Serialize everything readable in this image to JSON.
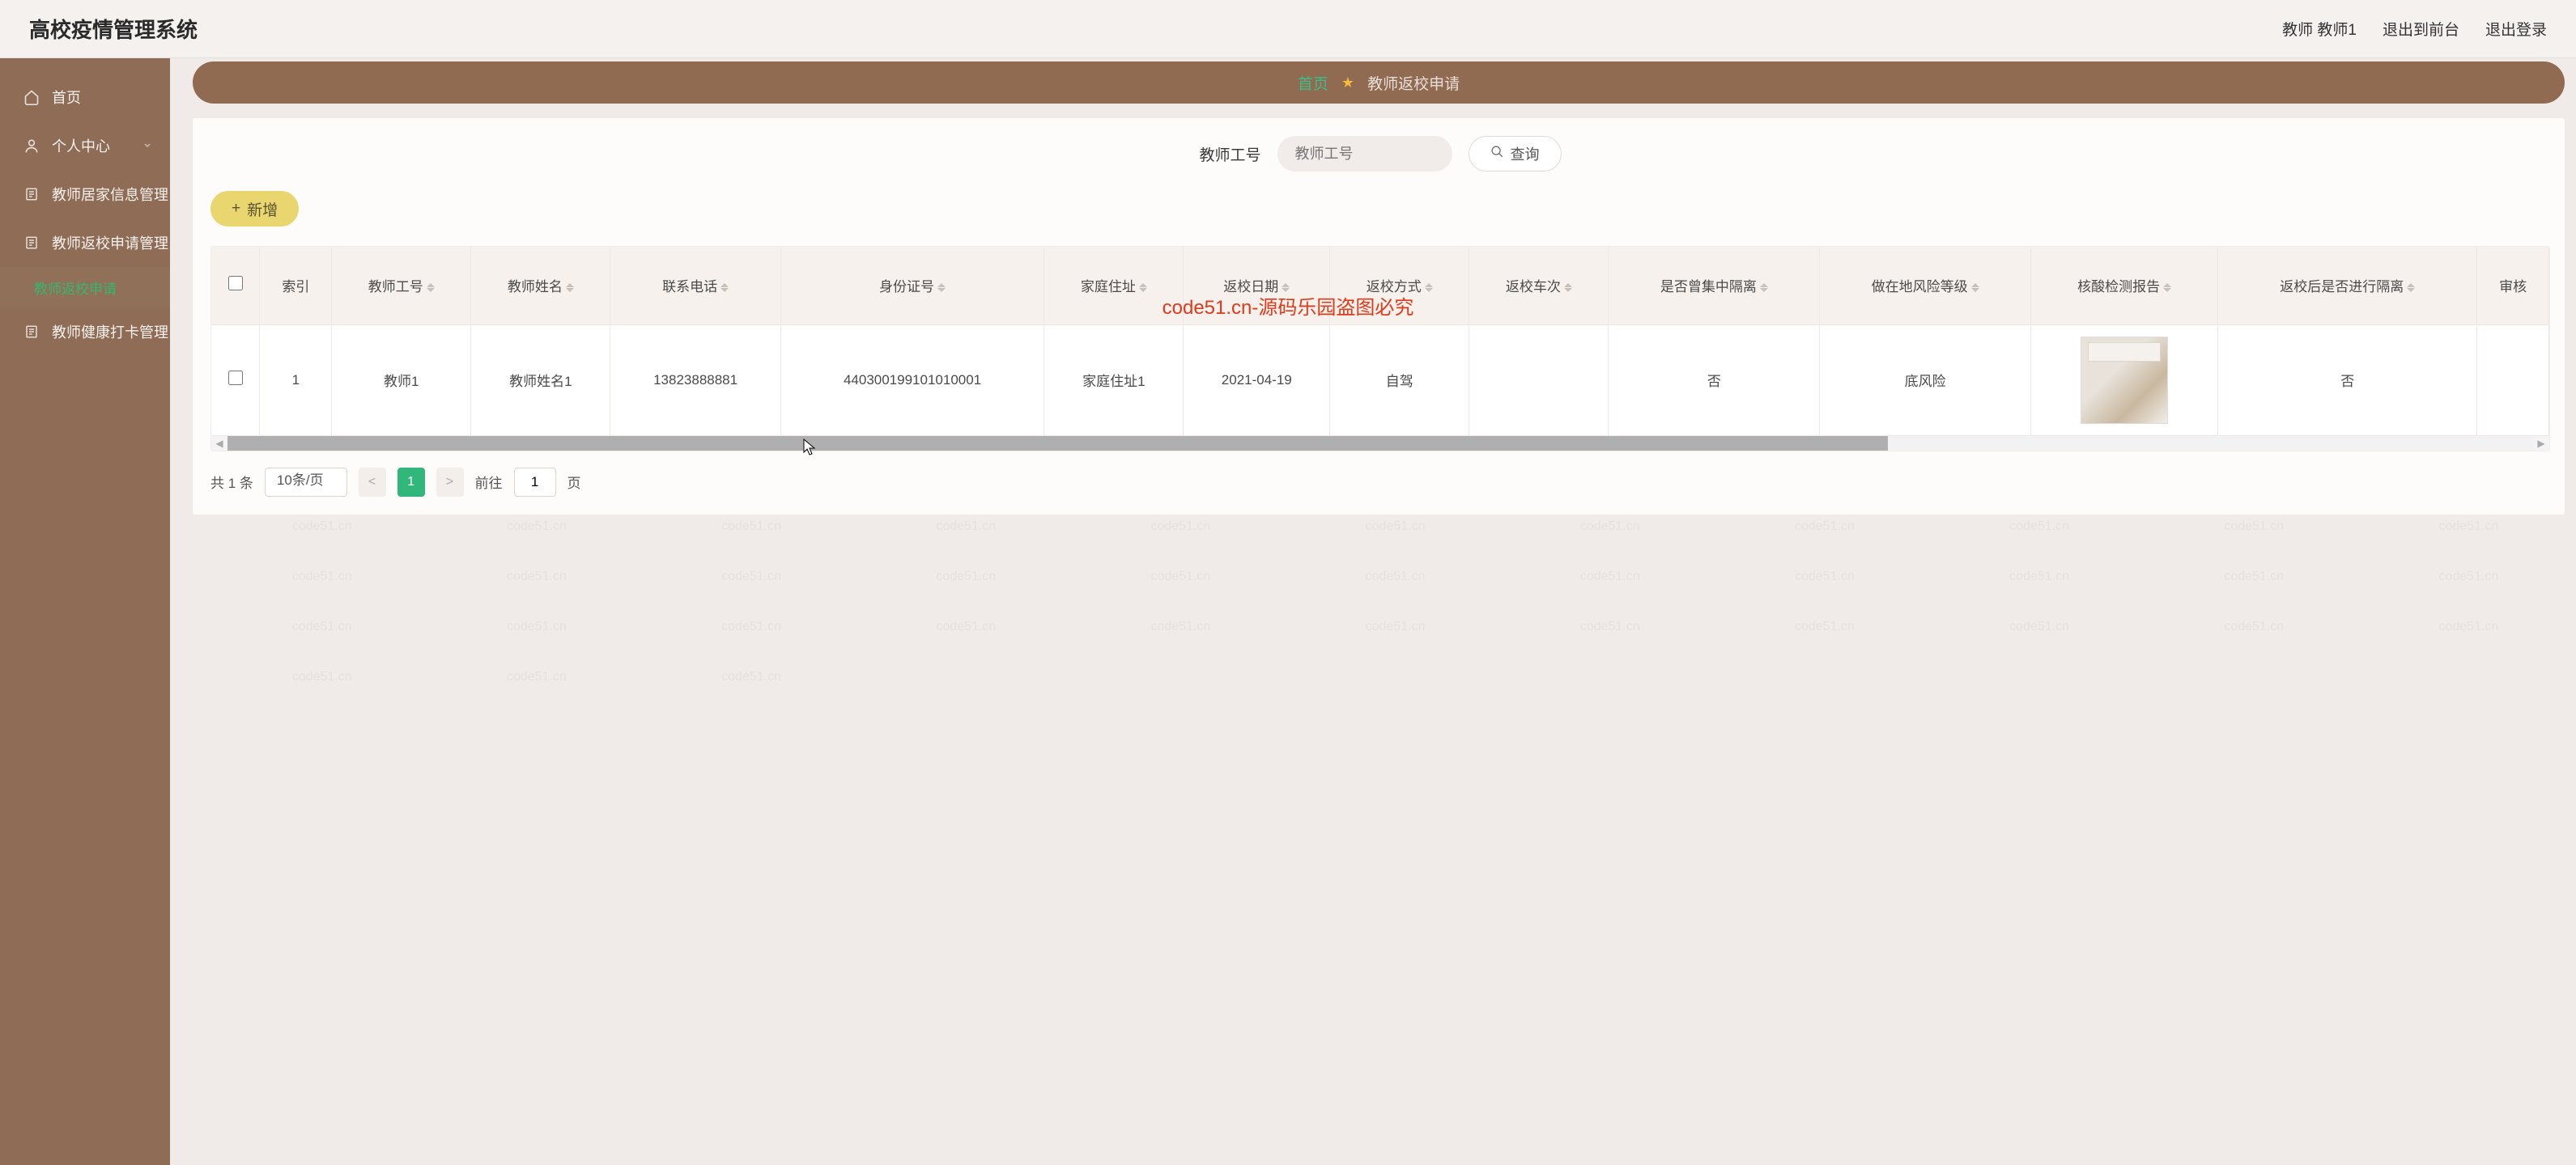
{
  "header": {
    "title": "高校疫情管理系统",
    "user_label": "教师 教师1",
    "exit_front": "退出到前台",
    "logout": "退出登录"
  },
  "sidebar": {
    "items": [
      {
        "icon": "home-icon",
        "label": "首页",
        "has_chevron": false
      },
      {
        "icon": "user-icon",
        "label": "个人中心",
        "has_chevron": true
      },
      {
        "icon": "doc-icon",
        "label": "教师居家信息管理",
        "has_chevron": false
      },
      {
        "icon": "doc-icon",
        "label": "教师返校申请管理",
        "has_chevron": true
      },
      {
        "icon": "doc-icon",
        "label": "教师健康打卡管理",
        "has_chevron": false
      }
    ],
    "active_subitem": "教师返校申请"
  },
  "breadcrumb": {
    "home": "首页",
    "current": "教师返校申请"
  },
  "search": {
    "label": "教师工号",
    "placeholder": "教师工号",
    "button": "查询"
  },
  "toolbar": {
    "add_label": "新增"
  },
  "table": {
    "columns": [
      "索引",
      "教师工号",
      "教师姓名",
      "联系电话",
      "身份证号",
      "家庭住址",
      "返校日期",
      "返校方式",
      "返校车次",
      "是否曾集中隔离",
      "做在地风险等级",
      "核酸检测报告",
      "返校后是否进行隔离",
      "审核"
    ],
    "rows": [
      {
        "index": "1",
        "teacher_id": "教师1",
        "teacher_name": "教师姓名1",
        "phone": "138238888​81",
        "id_card": "440300199101010001",
        "address": "家庭住址1",
        "return_date": "2021-04-19",
        "return_method": "自驾",
        "train_no": "",
        "was_quarantined": "否",
        "risk_level": "底风险",
        "report_img": "thumb",
        "post_quarantine": "否",
        "audit": ""
      }
    ]
  },
  "pagination": {
    "total_text": "共 1 条",
    "page_size": "10条/页",
    "current_page": "1",
    "goto_label": "前往",
    "goto_value": "1",
    "page_suffix": "页"
  },
  "watermark": {
    "cell": "code51.cn",
    "center": "code51.cn-源码乐园盗图必究"
  }
}
